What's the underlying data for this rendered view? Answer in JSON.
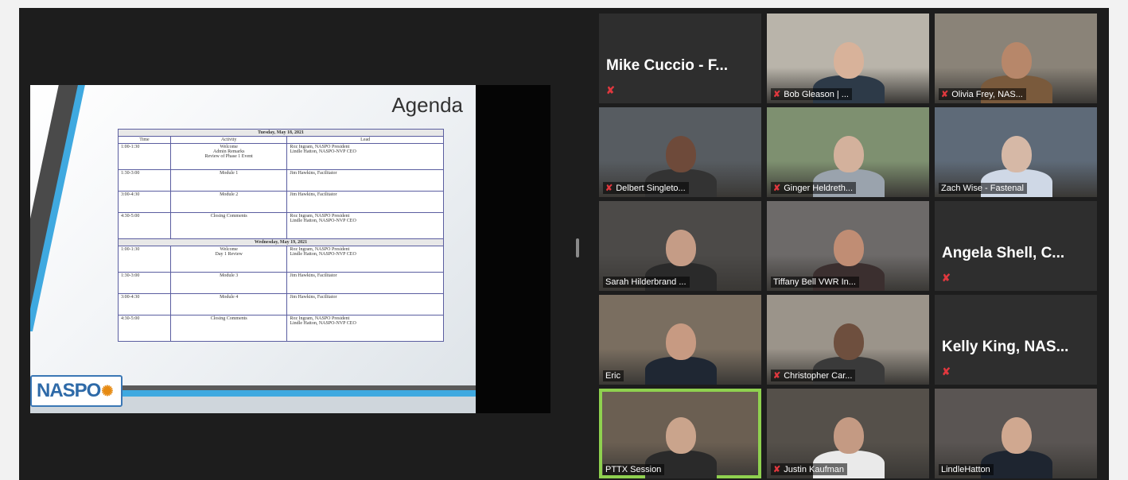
{
  "slide": {
    "title": "Agenda",
    "logo_text": "NASPO",
    "table": {
      "day1": "Tuesday, May 18, 2021",
      "headers": [
        "Time",
        "Activity",
        "Lead"
      ],
      "day1_rows": [
        {
          "time": "1:00-1:30",
          "activity": "Welcome\nAdmin Remarks\nReview of Phase 1 Event",
          "lead": "Roz Ingram, NASPO President\nLindle Hatton, NASPO-NVP CEO"
        },
        {
          "time": "1:30-3:00",
          "activity": "Module 1",
          "lead": "Jim Hawkins, Facilitator"
        },
        {
          "time": "3:00-4:30",
          "activity": "Module 2",
          "lead": "Jim Hawkins, Facilitator"
        },
        {
          "time": "4:30-5:00",
          "activity": "Closing Comments",
          "lead": "Roz Ingram, NASPO President\nLindle Hatton, NASPO-NVP CEO"
        }
      ],
      "day2": "Wednesday, May 19, 2021",
      "day2_rows": [
        {
          "time": "1:00-1:30",
          "activity": "Welcome\nDay 1 Review",
          "lead": "Roz Ingram, NASPO President\nLindle Hatton, NASPO-NVP CEO"
        },
        {
          "time": "1:30-3:00",
          "activity": "Module 3",
          "lead": "Jim Hawkins, Facilitator"
        },
        {
          "time": "3:00-4:30",
          "activity": "Module 4",
          "lead": "Jim Hawkins, Facilitator"
        },
        {
          "time": "4:30-5:00",
          "activity": "Closing Comments",
          "lead": "Roz Ingram, NASPO President\nLindle Hatton, NASPO-NVP CEO"
        }
      ]
    }
  },
  "participants": [
    {
      "name": "Mike Cuccio - F...",
      "video": false,
      "muted": true
    },
    {
      "name": "Bob Gleason | ...",
      "video": true,
      "muted": true
    },
    {
      "name": "Olivia Frey, NAS...",
      "video": true,
      "muted": true
    },
    {
      "name": "Delbert Singleto...",
      "video": true,
      "muted": true
    },
    {
      "name": "Ginger Heldreth...",
      "video": true,
      "muted": true
    },
    {
      "name": "Zach Wise - Fastenal",
      "video": true,
      "muted": false
    },
    {
      "name": "Sarah Hilderbrand ...",
      "video": true,
      "muted": false
    },
    {
      "name": "Tiffany Bell VWR In...",
      "video": true,
      "muted": false
    },
    {
      "name": "Angela Shell, C...",
      "video": false,
      "muted": true
    },
    {
      "name": "Eric",
      "video": true,
      "muted": false
    },
    {
      "name": "Christopher Car...",
      "video": true,
      "muted": true
    },
    {
      "name": "Kelly King, NAS...",
      "video": false,
      "muted": true
    },
    {
      "name": "PTTX Session",
      "video": true,
      "muted": false,
      "active_speaker": true
    },
    {
      "name": "Justin Kaufman",
      "video": true,
      "muted": true
    },
    {
      "name": "LindleHatton",
      "video": true,
      "muted": false
    }
  ],
  "icons": {
    "muted": "muted-mic-icon"
  },
  "colors": {
    "active_speaker": "#8fd14f",
    "muted": "#e0383e",
    "logo_blue": "#2e6aa8",
    "logo_orange": "#e68a12"
  }
}
